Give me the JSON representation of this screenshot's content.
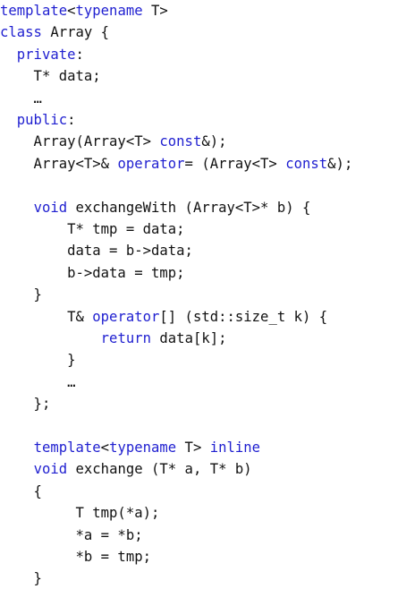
{
  "colors": {
    "keyword": "#1f1fd0",
    "text": "#111111",
    "background": "#ffffff"
  },
  "code": {
    "lines": [
      [
        {
          "t": "template",
          "k": "kw"
        },
        {
          "t": "<",
          "k": "plain"
        },
        {
          "t": "typename",
          "k": "kw"
        },
        {
          "t": " T>",
          "k": "plain"
        }
      ],
      [
        {
          "t": "class",
          "k": "kw"
        },
        {
          "t": " Array {",
          "k": "plain"
        }
      ],
      [
        {
          "t": "  ",
          "k": "plain"
        },
        {
          "t": "private",
          "k": "kw"
        },
        {
          "t": ":",
          "k": "plain"
        }
      ],
      [
        {
          "t": "    T* data;",
          "k": "plain"
        }
      ],
      [
        {
          "t": "    …",
          "k": "plain"
        }
      ],
      [
        {
          "t": "  ",
          "k": "plain"
        },
        {
          "t": "public",
          "k": "kw"
        },
        {
          "t": ":",
          "k": "plain"
        }
      ],
      [
        {
          "t": "    Array(Array<T> ",
          "k": "plain"
        },
        {
          "t": "const",
          "k": "kw"
        },
        {
          "t": "&);",
          "k": "plain"
        }
      ],
      [
        {
          "t": "    Array<T>& ",
          "k": "plain"
        },
        {
          "t": "operator",
          "k": "kw"
        },
        {
          "t": "= (Array<T> ",
          "k": "plain"
        },
        {
          "t": "const",
          "k": "kw"
        },
        {
          "t": "&);",
          "k": "plain"
        }
      ],
      [],
      [
        {
          "t": "    ",
          "k": "plain"
        },
        {
          "t": "void",
          "k": "kw"
        },
        {
          "t": " exchangeWith (Array<T>* b) {",
          "k": "plain"
        }
      ],
      [
        {
          "t": "        T* tmp = data;",
          "k": "plain"
        }
      ],
      [
        {
          "t": "        data = b->data;",
          "k": "plain"
        }
      ],
      [
        {
          "t": "        b->data = tmp;",
          "k": "plain"
        }
      ],
      [
        {
          "t": "    }",
          "k": "plain"
        }
      ],
      [
        {
          "t": "        T& ",
          "k": "plain"
        },
        {
          "t": "operator",
          "k": "kw"
        },
        {
          "t": "[] (std::size_t k) {",
          "k": "plain"
        }
      ],
      [
        {
          "t": "            ",
          "k": "plain"
        },
        {
          "t": "return",
          "k": "kw"
        },
        {
          "t": " data[k];",
          "k": "plain"
        }
      ],
      [
        {
          "t": "        }",
          "k": "plain"
        }
      ],
      [
        {
          "t": "        …",
          "k": "plain"
        }
      ],
      [
        {
          "t": "    };",
          "k": "plain"
        }
      ],
      [],
      [
        {
          "t": "    ",
          "k": "plain"
        },
        {
          "t": "template",
          "k": "kw"
        },
        {
          "t": "<",
          "k": "plain"
        },
        {
          "t": "typename",
          "k": "kw"
        },
        {
          "t": " T> ",
          "k": "plain"
        },
        {
          "t": "inline",
          "k": "kw"
        }
      ],
      [
        {
          "t": "    ",
          "k": "plain"
        },
        {
          "t": "void",
          "k": "kw"
        },
        {
          "t": " exchange (T* a, T* b)",
          "k": "plain"
        }
      ],
      [
        {
          "t": "    {",
          "k": "plain"
        }
      ],
      [
        {
          "t": "         T tmp(*a);",
          "k": "plain"
        }
      ],
      [
        {
          "t": "         *a = *b;",
          "k": "plain"
        }
      ],
      [
        {
          "t": "         *b = tmp;",
          "k": "plain"
        }
      ],
      [
        {
          "t": "    }",
          "k": "plain"
        }
      ]
    ]
  }
}
